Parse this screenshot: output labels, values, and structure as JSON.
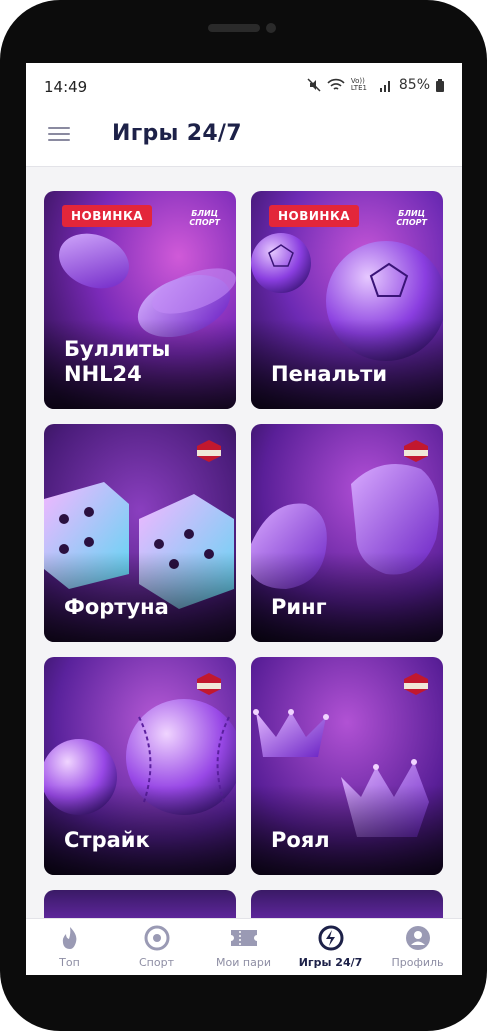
{
  "status": {
    "time": "14:49",
    "battery": "85%",
    "network": "Vo)) LTE1"
  },
  "header": {
    "title": "Игры 24/7"
  },
  "badges": {
    "new": "НОВИНКА",
    "brand_line1": "БЛИЦ",
    "brand_line2": "СПОРТ"
  },
  "games": [
    {
      "title": "Буллиты NHL24",
      "badge": true
    },
    {
      "title": "Пенальти",
      "badge": true
    },
    {
      "title": "Фортуна",
      "badge": false
    },
    {
      "title": "Ринг",
      "badge": false
    },
    {
      "title": "Страйк",
      "badge": false
    },
    {
      "title": "Роял",
      "badge": false
    }
  ],
  "tabs": [
    {
      "label": "Топ",
      "icon": "flame-icon"
    },
    {
      "label": "Спорт",
      "icon": "target-icon"
    },
    {
      "label": "Мои пари",
      "icon": "ticket-icon"
    },
    {
      "label": "Игры 24/7",
      "icon": "lightning-icon",
      "active": true
    },
    {
      "label": "Профиль",
      "icon": "user-icon"
    }
  ],
  "colors": {
    "accent": "#1d2148",
    "badge": "#e3263a",
    "card_purple": "#7b2fd0"
  }
}
